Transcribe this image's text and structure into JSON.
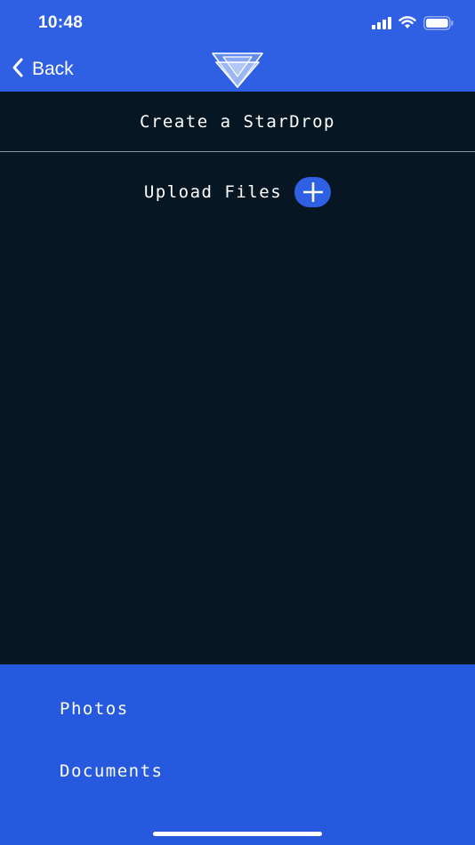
{
  "status_bar": {
    "time": "10:48",
    "signal_icon": "cellular-signal-icon",
    "wifi_icon": "wifi-icon",
    "battery_icon": "battery-icon"
  },
  "nav": {
    "back_label": "Back",
    "back_icon": "chevron-left-icon",
    "logo": "stardrop-logo"
  },
  "page": {
    "title": "Create a StarDrop"
  },
  "upload": {
    "label": "Upload Files",
    "icon": "plus-icon"
  },
  "sheet": {
    "items": [
      {
        "label": "Photos"
      },
      {
        "label": "Documents"
      }
    ]
  },
  "colors": {
    "accent": "#2f60e3",
    "sheet": "#2659dd",
    "background": "#061622",
    "divider": "#8a97a3"
  }
}
